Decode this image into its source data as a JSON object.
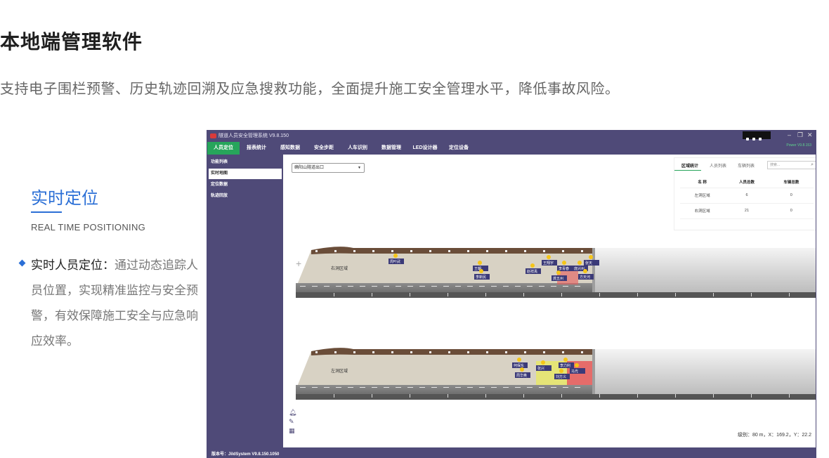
{
  "headline": "本地端管理软件",
  "subline": "支持电子围栏预警、历史轨迹回溯及应急搜救功能，全面提升施工安全管理水平，降低事故风险。",
  "feature": {
    "title": "实时定位",
    "en": "REAL TIME POSITIONING",
    "bullet_label": "实时人员定位：",
    "bullet_text": "通过动态追踪人员位置，实现精准监控与安全预警，有效保障施工安全与应急响应效率。"
  },
  "app": {
    "title": "隧道人员安全管理系统 V9.8.150",
    "version_tag": "Power V9.8.153",
    "menu": [
      "人员定位",
      "报表统计",
      "感知数据",
      "安全步距",
      "人车识别",
      "数据管理",
      "LED设计器",
      "定位设备"
    ],
    "active_menu": "人员定位",
    "sidebar": [
      "功能列表",
      "实时地图",
      "定位数据",
      "轨迹回放"
    ],
    "active_sidebar": "实时地图",
    "select_value": "确阳山隧道出口",
    "stats": {
      "tabs": [
        "区域统计",
        "人员列表",
        "车辆列表"
      ],
      "search_placeholder": "搜索...",
      "columns": [
        "名 称",
        "人员总数",
        "车辆总数"
      ],
      "rows": [
        [
          "左洞区域",
          "6",
          "0"
        ],
        [
          "右洞区域",
          "21",
          "0"
        ]
      ]
    },
    "tunnels": [
      {
        "label": "右洞区域",
        "people": [
          "周叶武",
          "王朝",
          "李新民",
          "赵祥禹",
          "王翔宇",
          "李青春",
          "龚五州",
          "庞兴州",
          "张天",
          "方天河"
        ]
      },
      {
        "label": "左洞区域",
        "people": [
          "何保东",
          "周华奥",
          "张兴",
          "李力利",
          "马光",
          "刘方义"
        ]
      }
    ],
    "map_tools": [
      "bell-icon",
      "edit-icon",
      "layers-icon"
    ],
    "coords": "级别：80 m，X：169.2，Y：22.2",
    "status": "版本号：JildSystem V9.8.150.1050",
    "colors": {
      "frame": "#4f4a78",
      "accent": "#27a55b"
    }
  }
}
